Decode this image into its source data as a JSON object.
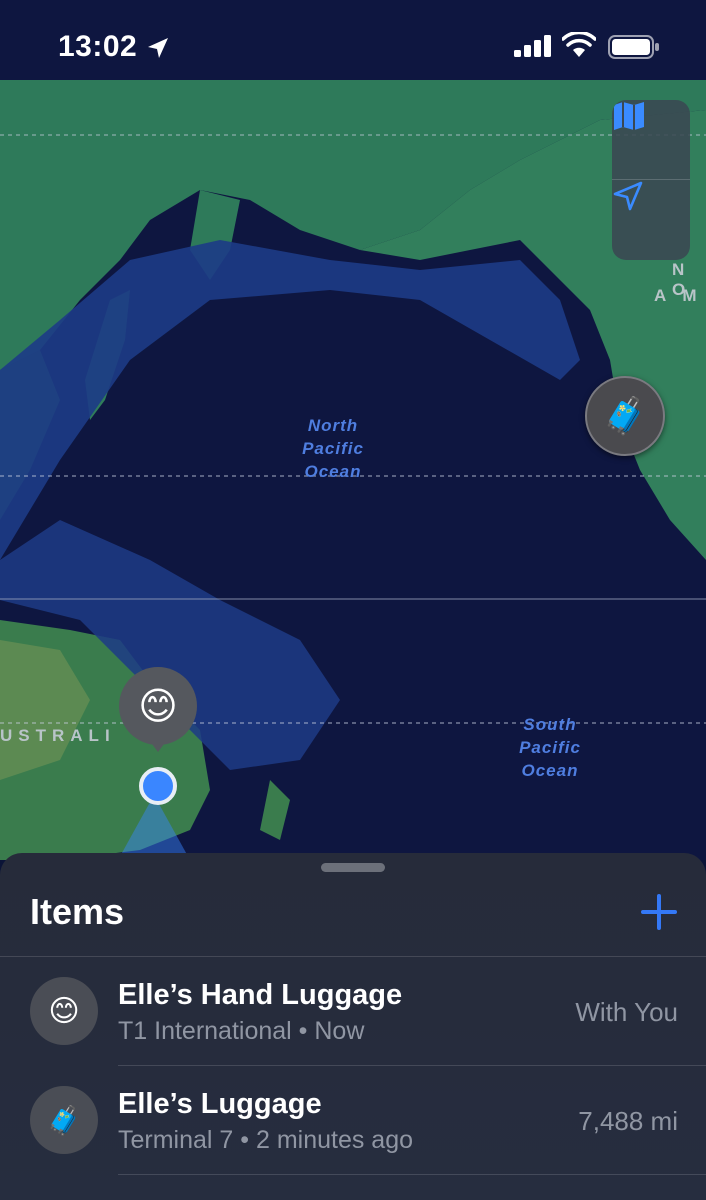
{
  "status_bar": {
    "time": "13:02",
    "icons": [
      "location-arrow-icon",
      "cellular-signal-icon",
      "wifi-icon",
      "battery-icon"
    ]
  },
  "map": {
    "ocean_labels": {
      "north_pacific": [
        "North",
        "Pacific",
        "Ocean"
      ],
      "south_pacific": [
        "South",
        "Pacific",
        "Ocean"
      ]
    },
    "land_labels": {
      "australia": "USTRALI",
      "north_america_line1": "N O",
      "north_america_line2": "A M"
    },
    "controls": [
      "map-icon",
      "location-arrow-icon"
    ],
    "pins": [
      {
        "name": "Elle’s Luggage",
        "emoji": "🧳"
      },
      {
        "name": "Elle’s Hand Luggage",
        "emoji": "😊"
      }
    ]
  },
  "sheet": {
    "title": "Items",
    "add_icon": "plus-icon",
    "items": [
      {
        "emoji": "😊",
        "name": "Elle’s Hand Luggage",
        "subtitle": "T1 International • Now",
        "status": "With You"
      },
      {
        "emoji": "🧳",
        "name": "Elle’s Luggage",
        "subtitle": "Terminal 7 • 2 minutes ago",
        "status": "7,488 mi"
      }
    ]
  },
  "colors": {
    "accent": "#3478f6",
    "ocean_deep": "#0e1640",
    "ocean_shelf": "#1c3a84",
    "land_green": "#2f7d5a",
    "sheet_bg": "#262b3a"
  }
}
